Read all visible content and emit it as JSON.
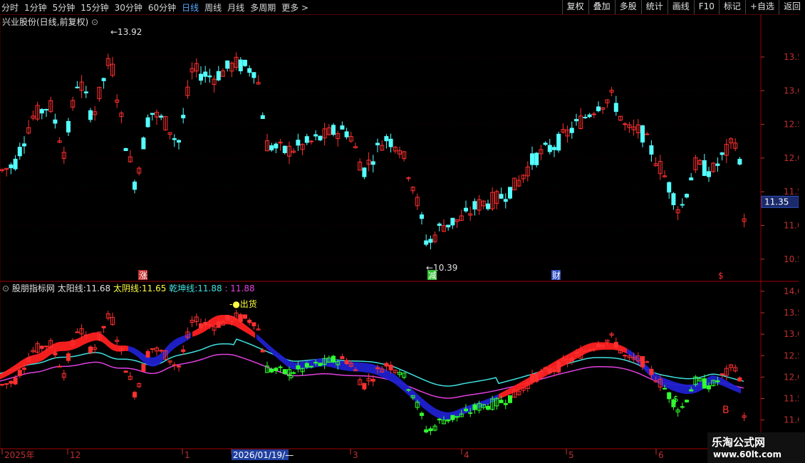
{
  "toolbar": {
    "periods": [
      "分时",
      "1分钟",
      "5分钟",
      "15分钟",
      "30分钟",
      "60分钟",
      "日线",
      "周线",
      "月线",
      "多周期",
      "更多 >"
    ],
    "active_period": "日线",
    "actions": [
      "复权",
      "叠加",
      "多股",
      "统计",
      "画线",
      "F10",
      "标记",
      "+自选",
      "返回"
    ]
  },
  "main": {
    "title": "兴业股份(日线,前复权)",
    "high_marker": "13.92",
    "low_marker": "10.39",
    "price_ticks": [
      "13.50",
      "13.00",
      "12.50",
      "12.00",
      "11.50",
      "11.00",
      "10.50"
    ],
    "current_price": "11.35",
    "event_markers": [
      "涨",
      "减",
      "财",
      "$"
    ]
  },
  "indicator": {
    "name": "股朋指标网",
    "sun_label": "太阳线:",
    "sun_value": "11.68",
    "moon_label": "太阴线:",
    "moon_value": "11.65",
    "qk_label": "乾坤线:",
    "qk_value": "11.88",
    "extra_value": ": 11.88",
    "signal_text": "出货",
    "ticks": [
      "14.00",
      "13.50",
      "13.00",
      "12.50",
      "12.00",
      "11.50",
      "11.00"
    ],
    "buy_marks": [
      "$",
      "$"
    ],
    "b_mark": "B"
  },
  "date_axis": {
    "labels": [
      "2025年",
      "12",
      "1",
      "2026/01/19/—",
      "3",
      "4",
      "5",
      "6"
    ]
  },
  "watermark": {
    "line1": "乐淘公式网",
    "line2": "www.60lt.com"
  },
  "colors": {
    "up": "#ff3030",
    "down": "#54ffff",
    "sun": "#ff2020",
    "moon": "#2020d0",
    "qk": "#40e0e0",
    "line4": "#e040e0",
    "green": "#30ff30"
  }
}
